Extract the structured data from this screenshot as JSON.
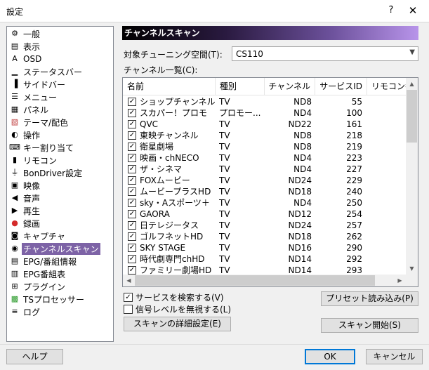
{
  "window": {
    "title": "設定",
    "help_glyph": "?",
    "close_glyph": "✕"
  },
  "sidebar": {
    "items": [
      {
        "label": "一般",
        "icon": "gear-icon"
      },
      {
        "label": "表示",
        "icon": "window-icon"
      },
      {
        "label": "OSD",
        "icon": "osd-icon"
      },
      {
        "label": "ステータスバー",
        "icon": "statusbar-icon"
      },
      {
        "label": "サイドバー",
        "icon": "sidebar-icon"
      },
      {
        "label": "メニュー",
        "icon": "menu-icon"
      },
      {
        "label": "パネル",
        "icon": "panel-icon"
      },
      {
        "label": "テーマ/配色",
        "icon": "theme-icon"
      },
      {
        "label": "操作",
        "icon": "mouse-icon"
      },
      {
        "label": "キー割り当て",
        "icon": "keyboard-icon"
      },
      {
        "label": "リモコン",
        "icon": "remote-icon"
      },
      {
        "label": "BonDriver設定",
        "icon": "plug-icon"
      },
      {
        "label": "映像",
        "icon": "film-icon"
      },
      {
        "label": "音声",
        "icon": "speaker-icon"
      },
      {
        "label": "再生",
        "icon": "play-icon"
      },
      {
        "label": "録画",
        "icon": "record-icon"
      },
      {
        "label": "キャプチャ",
        "icon": "camera-icon"
      },
      {
        "label": "チャンネルスキャン",
        "icon": "scan-icon"
      },
      {
        "label": "EPG/番組情報",
        "icon": "epg-icon"
      },
      {
        "label": "EPG番組表",
        "icon": "epg-table-icon"
      },
      {
        "label": "プラグイン",
        "icon": "plugin-icon"
      },
      {
        "label": "TSプロセッサー",
        "icon": "processor-icon"
      },
      {
        "label": "ログ",
        "icon": "log-icon"
      }
    ],
    "selected_index": 17
  },
  "panel": {
    "header": "チャンネルスキャン",
    "space_label": "対象チューニング空間(T):",
    "space_value": "CS110",
    "list_label": "チャンネル一覧(C):",
    "columns": [
      "名前",
      "種別",
      "チャンネル",
      "サービスID",
      "リモコン番号"
    ],
    "rows": [
      {
        "name": "ショップチャンネル",
        "type": "TV",
        "channel": "ND8",
        "sid": "55",
        "checked": true
      },
      {
        "name": "スカパー！プロモ",
        "type": "プロモー...",
        "channel": "ND4",
        "sid": "100",
        "checked": true
      },
      {
        "name": "QVC",
        "type": "TV",
        "channel": "ND22",
        "sid": "161",
        "checked": true
      },
      {
        "name": "東映チャンネル",
        "type": "TV",
        "channel": "ND8",
        "sid": "218",
        "checked": true
      },
      {
        "name": "衛星劇場",
        "type": "TV",
        "channel": "ND8",
        "sid": "219",
        "checked": true
      },
      {
        "name": "映画・chNECO",
        "type": "TV",
        "channel": "ND4",
        "sid": "223",
        "checked": true
      },
      {
        "name": "ザ・シネマ",
        "type": "TV",
        "channel": "ND4",
        "sid": "227",
        "checked": true
      },
      {
        "name": "FOXムービー",
        "type": "TV",
        "channel": "ND24",
        "sid": "229",
        "checked": true
      },
      {
        "name": "ムービープラスHD",
        "type": "TV",
        "channel": "ND18",
        "sid": "240",
        "checked": true
      },
      {
        "name": "sky・Aスポーツ＋",
        "type": "TV",
        "channel": "ND4",
        "sid": "250",
        "checked": true
      },
      {
        "name": "GAORA",
        "type": "TV",
        "channel": "ND12",
        "sid": "254",
        "checked": true
      },
      {
        "name": "日テレジータス",
        "type": "TV",
        "channel": "ND24",
        "sid": "257",
        "checked": true
      },
      {
        "name": "ゴルフネットHD",
        "type": "TV",
        "channel": "ND18",
        "sid": "262",
        "checked": true
      },
      {
        "name": "SKY STAGE",
        "type": "TV",
        "channel": "ND16",
        "sid": "290",
        "checked": true
      },
      {
        "name": "時代劇専門chHD",
        "type": "TV",
        "channel": "ND14",
        "sid": "292",
        "checked": true
      },
      {
        "name": "ファミリー劇場HD",
        "type": "TV",
        "channel": "ND14",
        "sid": "293",
        "checked": true
      }
    ],
    "check_mark": "✓",
    "svc_check_label": "サービスを検索する(V)",
    "svc_checked": true,
    "level_check_label": "信号レベルを無視する(L)",
    "level_checked": false,
    "detail_button": "スキャンの詳細設定(E)",
    "preset_button": "プリセット読み込み(P)",
    "scan_button": "スキャン開始(S)"
  },
  "footer": {
    "help_button": "ヘルプ",
    "ok_button": "OK",
    "cancel_button": "キャンセル"
  }
}
